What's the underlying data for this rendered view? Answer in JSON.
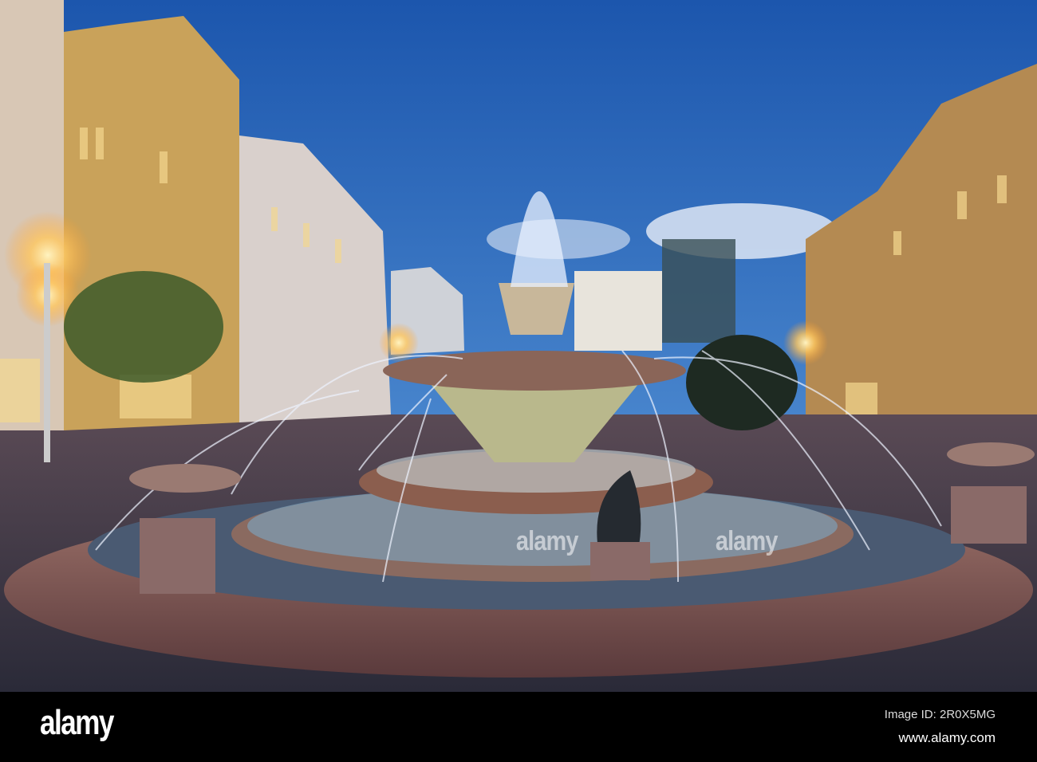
{
  "photo": {
    "subject": "fountain in city square at dusk",
    "colors": {
      "sky_top": "#1f5fb8",
      "sky_low": "#4a88cf",
      "stone": "#7a5a55",
      "light": "#ffd27a"
    }
  },
  "watermark": {
    "text": "alamy"
  },
  "footer": {
    "logo": "alamy",
    "image_id": "Image ID: 2R0X5MG",
    "url": "www.alamy.com"
  }
}
